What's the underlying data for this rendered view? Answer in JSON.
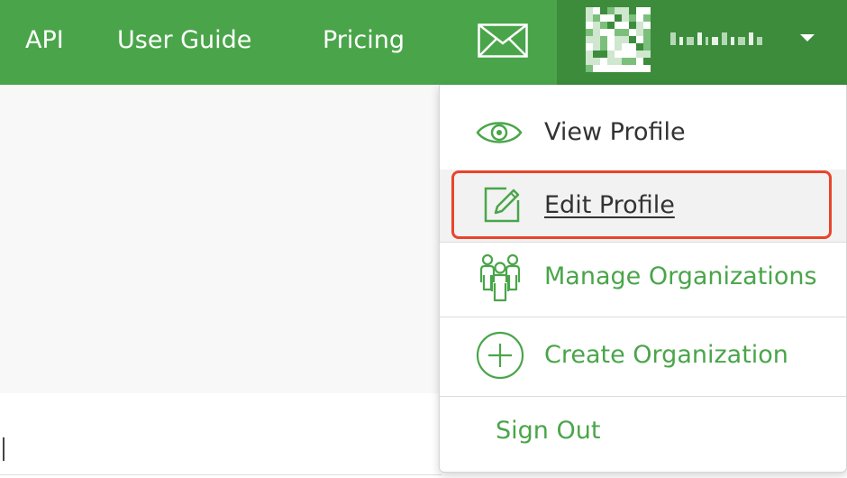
{
  "nav": {
    "links": [
      "API",
      "User Guide",
      "Pricing"
    ],
    "mail_icon": "envelope-icon",
    "user_avatar_icon": "identicon-avatar",
    "caret_icon": "caret-down-icon"
  },
  "dropdown": {
    "items": [
      {
        "label": "View Profile",
        "icon": "eye-icon"
      },
      {
        "label": "Edit Profile",
        "icon": "edit-pencil-icon"
      },
      {
        "label": "Manage Organizations",
        "icon": "people-group-icon"
      },
      {
        "label": "Create Organization",
        "icon": "plus-circle-icon"
      },
      {
        "label": "Sign Out"
      }
    ]
  },
  "colors": {
    "brand_green": "#4aa54a",
    "user_menu_green": "#3c8c3c",
    "highlight_red": "#e8452c"
  }
}
